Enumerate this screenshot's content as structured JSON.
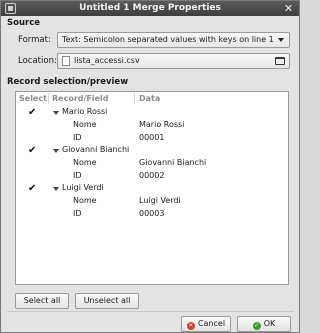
{
  "window": {
    "title": "Untitled 1 Merge Properties",
    "close_glyph": "✕"
  },
  "source": {
    "title": "Source",
    "format_label": "Format:",
    "format_value": "Text: Semicolon separated values with keys on line 1",
    "location_label": "Location:",
    "location_value": "lista_accessi.csv"
  },
  "records": {
    "title": "Record selection/preview",
    "columns": [
      "Select",
      "Record/Field",
      "Data"
    ],
    "items": [
      {
        "checked": true,
        "name": "Mario Rossi",
        "fields": [
          {
            "field": "Nome",
            "data": "Mario Rossi"
          },
          {
            "field": "ID",
            "data": "00001"
          }
        ]
      },
      {
        "checked": true,
        "name": "Giovanni Bianchi",
        "fields": [
          {
            "field": "Nome",
            "data": "Giovanni Bianchi"
          },
          {
            "field": "ID",
            "data": "00002"
          }
        ]
      },
      {
        "checked": true,
        "name": "Luigi Verdi",
        "fields": [
          {
            "field": "Nome",
            "data": "Luigi Verdi"
          },
          {
            "field": "ID",
            "data": "00003"
          }
        ]
      }
    ]
  },
  "buttons": {
    "select_all": "Select all",
    "unselect_all": "Unselect all",
    "cancel": "Cancel",
    "ok": "OK"
  },
  "check_glyph": "✔",
  "icons": {
    "window": "window-icon",
    "close": "close-icon",
    "file": "file-icon",
    "folder": "folder-open-icon",
    "cancel": "cancel-icon",
    "ok": "ok-icon",
    "expander": "expander-down-icon"
  },
  "colors": {
    "titlebar": "#4a4a4a",
    "cancel": "#d23c2c",
    "ok": "#3e9a2f"
  }
}
